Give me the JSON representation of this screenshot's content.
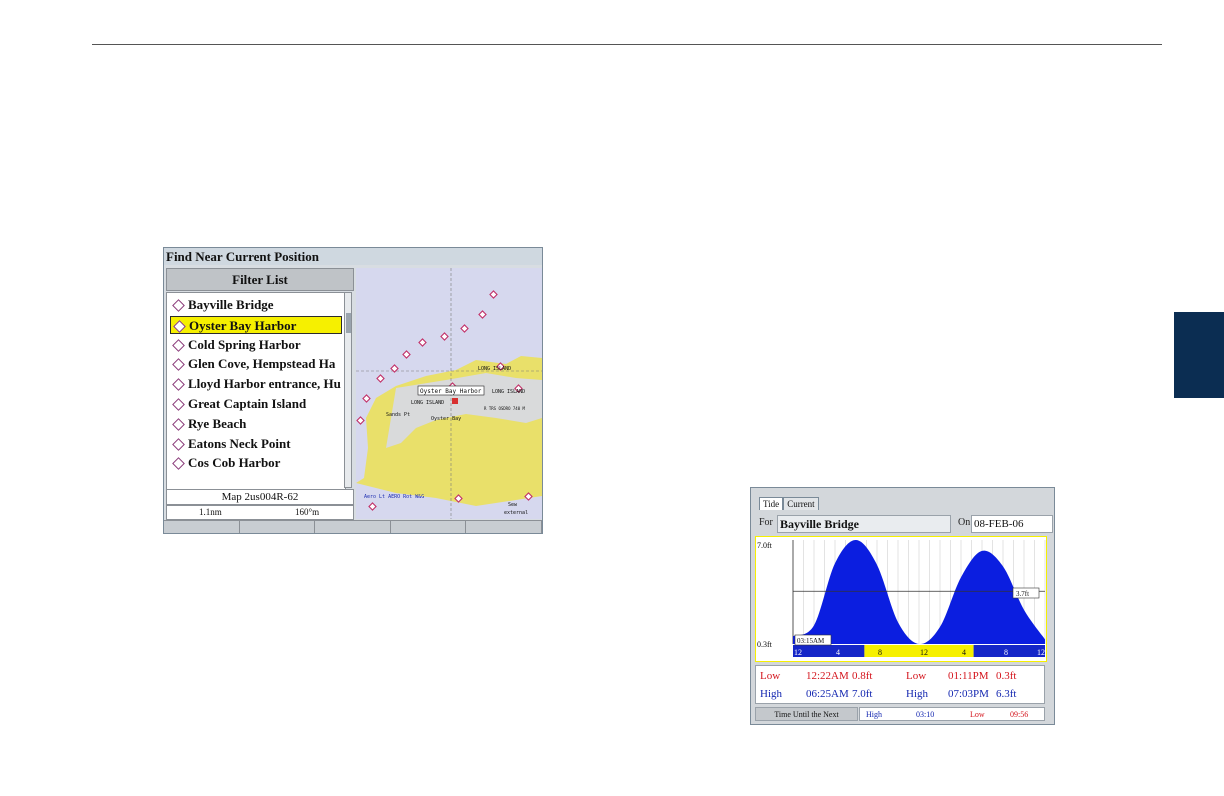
{
  "find_screen": {
    "title": "Find Near Current Position",
    "filter_label": "Filter List",
    "items": [
      {
        "label": "Bayville Bridge",
        "selected": false
      },
      {
        "label": "Oyster Bay Harbor",
        "selected": true
      },
      {
        "label": "Cold Spring Harbor",
        "selected": false
      },
      {
        "label": "Glen Cove, Hempstead Ha",
        "selected": false
      },
      {
        "label": "Lloyd Harbor entrance, Hu",
        "selected": false
      },
      {
        "label": "Great Captain Island",
        "selected": false
      },
      {
        "label": "Rye Beach",
        "selected": false
      },
      {
        "label": "Eatons Neck Point",
        "selected": false
      },
      {
        "label": "Cos Cob Harbor",
        "selected": false
      }
    ],
    "map_name": "Map 2us004R-62",
    "scale_left": "1.1nm",
    "scale_right": "160°m",
    "map": {
      "selected_label": "Oyster Bay Harbor",
      "labels": [
        "LONG ISLAND",
        "LONG ISLAND",
        "Oyster Bay",
        "Sands Pt",
        "Aero Lt AERO Rot W&G",
        "Sew",
        "external",
        "LONG ISLAND",
        "R TRS OSDRO 740 M"
      ]
    }
  },
  "tide_screen": {
    "tabs": [
      "Tide",
      "Current"
    ],
    "for_label": "For",
    "station": "Bayville Bridge",
    "on_label": "On",
    "date": "08-FEB-06",
    "chart_data": {
      "type": "area",
      "ylim_labels": {
        "top": "7.0ft",
        "bottom": "0.3ft"
      },
      "ylim": [
        0.3,
        7.0
      ],
      "x_ticks": [
        "12",
        "4",
        "8",
        "12",
        "4",
        "8",
        "12"
      ],
      "x": [
        0,
        2,
        4,
        6,
        8,
        10,
        12,
        14,
        16,
        18,
        20,
        22,
        24
      ],
      "values": [
        0.8,
        1.5,
        5.5,
        7.0,
        5.4,
        1.7,
        0.3,
        1.4,
        4.6,
        6.3,
        5.3,
        2.5,
        0.6
      ],
      "cursor_label": "03:15AM",
      "current_level_label": "3.7ft",
      "current_level": 3.7,
      "colors": {
        "fill": "#0b1ee0",
        "day": "#f6f000",
        "night": "#1526c8",
        "frame": "#f6f000"
      }
    },
    "rows": [
      {
        "type1": "Low",
        "time1": "12:22AM",
        "height1": "0.8ft",
        "type2": "Low",
        "time2": "01:11PM",
        "height2": "0.3ft",
        "color": "red"
      },
      {
        "type1": "High",
        "time1": "06:25AM",
        "height1": "7.0ft",
        "type2": "High",
        "time2": "07:03PM",
        "height2": "6.3ft",
        "color": "blue"
      }
    ],
    "footer": {
      "label": "Time Until the Next",
      "next_high_label": "High",
      "next_high": "03:10",
      "next_low_label": "Low",
      "next_low": "09:56"
    }
  }
}
